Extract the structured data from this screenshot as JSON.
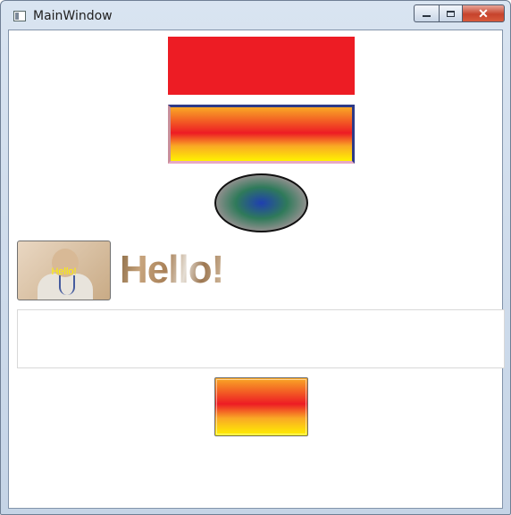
{
  "window": {
    "title": "MainWindow",
    "controls": {
      "minimize": "",
      "maximize": "",
      "close": "✕"
    }
  },
  "content": {
    "thumbnail_button": {
      "label": "Hello!"
    },
    "hello_text": "Hello!"
  },
  "colors": {
    "red_rect": "#ed1c24",
    "gradient_orange": "#f9a825",
    "gradient_red": "#ed1c24",
    "gradient_yellow": "#fff200",
    "ellipse_center": "#1f3fb0",
    "ellipse_mid": "#2f7a5a",
    "ellipse_outer": "#e8a3bd"
  }
}
